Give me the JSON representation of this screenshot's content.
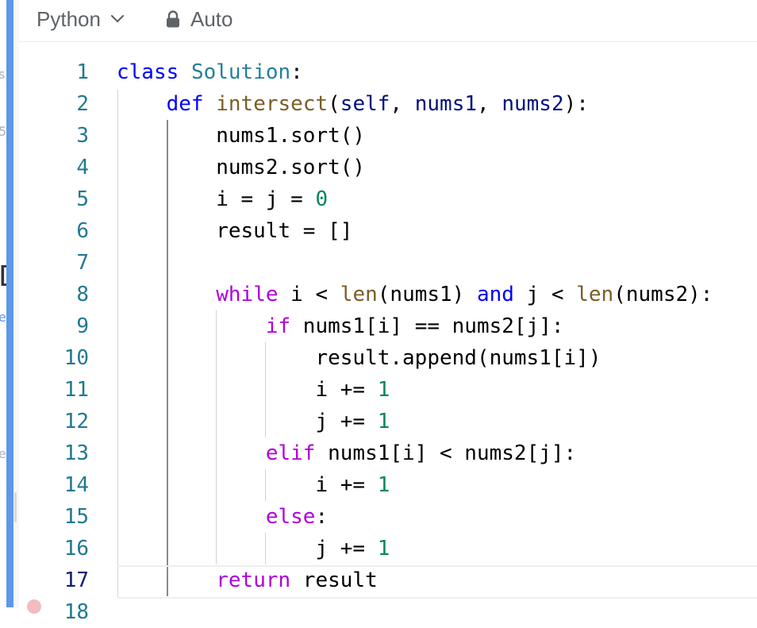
{
  "toolbar": {
    "language": "Python",
    "language_icon": "chevron-down-icon",
    "autocomplete_label": "Auto",
    "autocomplete_icon": "lock-icon"
  },
  "left_fragments": [
    "s",
    "5",
    "D",
    "e",
    "e"
  ],
  "editor": {
    "active_line": 17,
    "lines": [
      {
        "n": "1",
        "tokens": [
          {
            "t": "class",
            "c": "kw"
          },
          {
            "t": " "
          },
          {
            "t": "Solution",
            "c": "cls"
          },
          {
            "t": ":"
          }
        ]
      },
      {
        "n": "2",
        "tokens": [
          {
            "t": "    "
          },
          {
            "t": "def",
            "c": "kw"
          },
          {
            "t": " "
          },
          {
            "t": "intersect",
            "c": "fn"
          },
          {
            "t": "("
          },
          {
            "t": "self",
            "c": "var"
          },
          {
            "t": ", "
          },
          {
            "t": "nums1",
            "c": "var"
          },
          {
            "t": ", "
          },
          {
            "t": "nums2",
            "c": "var"
          },
          {
            "t": "):"
          }
        ]
      },
      {
        "n": "3",
        "tokens": [
          {
            "t": "        nums1.sort()"
          }
        ]
      },
      {
        "n": "4",
        "tokens": [
          {
            "t": "        nums2.sort()"
          }
        ]
      },
      {
        "n": "5",
        "tokens": [
          {
            "t": "        i = j = "
          },
          {
            "t": "0",
            "c": "num"
          }
        ]
      },
      {
        "n": "6",
        "tokens": [
          {
            "t": "        result = []"
          }
        ]
      },
      {
        "n": "7",
        "tokens": [
          {
            "t": ""
          }
        ]
      },
      {
        "n": "8",
        "tokens": [
          {
            "t": "        "
          },
          {
            "t": "while",
            "c": "ctl"
          },
          {
            "t": " i < "
          },
          {
            "t": "len",
            "c": "fn"
          },
          {
            "t": "(nums1) "
          },
          {
            "t": "and",
            "c": "kw"
          },
          {
            "t": " j < "
          },
          {
            "t": "len",
            "c": "fn"
          },
          {
            "t": "(nums2):"
          }
        ]
      },
      {
        "n": "9",
        "tokens": [
          {
            "t": "            "
          },
          {
            "t": "if",
            "c": "ctl"
          },
          {
            "t": " nums1[i] == nums2[j]:"
          }
        ]
      },
      {
        "n": "10",
        "tokens": [
          {
            "t": "                result.append(nums1[i])"
          }
        ]
      },
      {
        "n": "11",
        "tokens": [
          {
            "t": "                i += "
          },
          {
            "t": "1",
            "c": "num"
          }
        ]
      },
      {
        "n": "12",
        "tokens": [
          {
            "t": "                j += "
          },
          {
            "t": "1",
            "c": "num"
          }
        ]
      },
      {
        "n": "13",
        "tokens": [
          {
            "t": "            "
          },
          {
            "t": "elif",
            "c": "ctl"
          },
          {
            "t": " nums1[i] < nums2[j]:"
          }
        ]
      },
      {
        "n": "14",
        "tokens": [
          {
            "t": "                i += "
          },
          {
            "t": "1",
            "c": "num"
          }
        ]
      },
      {
        "n": "15",
        "tokens": [
          {
            "t": "            "
          },
          {
            "t": "else",
            "c": "ctl"
          },
          {
            "t": ":"
          }
        ]
      },
      {
        "n": "16",
        "tokens": [
          {
            "t": "                j += "
          },
          {
            "t": "1",
            "c": "num"
          }
        ]
      },
      {
        "n": "17",
        "tokens": [
          {
            "t": "        "
          },
          {
            "t": "return",
            "c": "ctl"
          },
          {
            "t": " result"
          }
        ]
      },
      {
        "n": "18",
        "tokens": [
          {
            "t": ""
          }
        ]
      }
    ]
  },
  "colors": {
    "keyword": "#0000ff",
    "control": "#af00db",
    "class": "#267f99",
    "function": "#795e26",
    "parameter": "#001080",
    "number": "#098658",
    "line_number": "#237893",
    "active_line_number": "#0b216f",
    "accent_bar": "#5e98ea"
  }
}
